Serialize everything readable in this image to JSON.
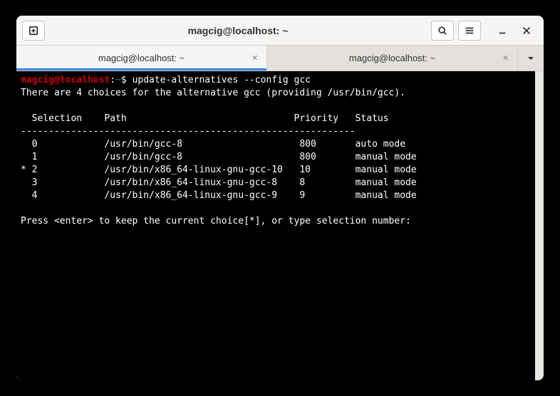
{
  "title": "magcig@localhost: ~",
  "tabs": [
    {
      "label": "magcig@localhost: ~"
    },
    {
      "label": "magcig@localhost: ~"
    }
  ],
  "prompt": {
    "user": "magcig",
    "host": "localhost",
    "cwd": "~",
    "symbol": "$",
    "command": "update-alternatives --config gcc"
  },
  "output": {
    "intro": "There are 4 choices for the alternative gcc (providing /usr/bin/gcc).",
    "header": "  Selection    Path                              Priority   Status",
    "divider": "------------------------------------------------------------",
    "rows": [
      "  0            /usr/bin/gcc-8                     800       auto mode",
      "  1            /usr/bin/gcc-8                     800       manual mode",
      "* 2            /usr/bin/x86_64-linux-gnu-gcc-10   10        manual mode",
      "  3            /usr/bin/x86_64-linux-gnu-gcc-8    8         manual mode",
      "  4            /usr/bin/x86_64-linux-gnu-gcc-9    9         manual mode"
    ],
    "footer": "Press <enter> to keep the current choice[*], or type selection number:"
  }
}
